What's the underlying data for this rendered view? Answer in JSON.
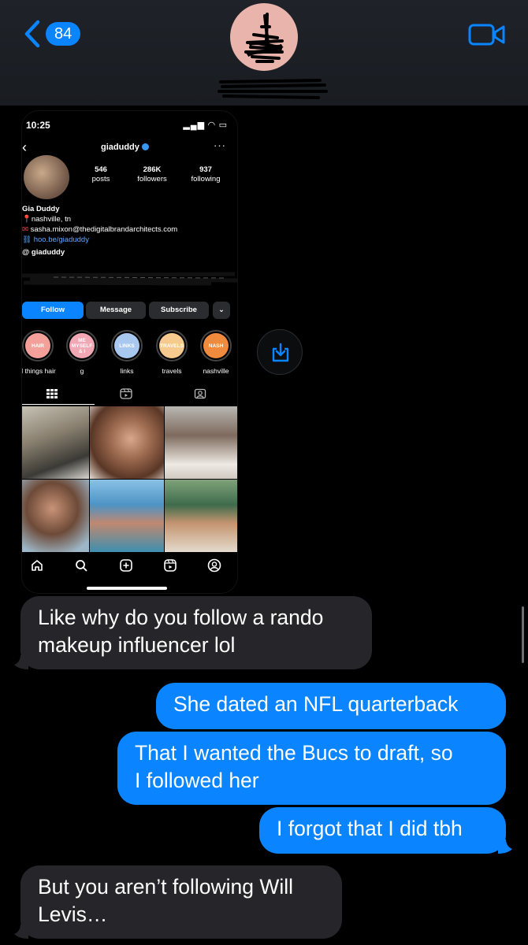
{
  "header": {
    "unread_count": "84",
    "colors": {
      "accent": "#0a84ff",
      "avatar_bg": "#e8b4ab"
    }
  },
  "attachment": {
    "status_time": "10:25",
    "username": "giaduddy",
    "stats": [
      {
        "num": "546",
        "label": "posts"
      },
      {
        "num": "286K",
        "label": "followers"
      },
      {
        "num": "937",
        "label": "following"
      }
    ],
    "bio": {
      "name": "Gia Duddy",
      "location": "nashville, tn",
      "email": "sasha.mixon@thedigitalbrandarchitects.com",
      "link": "hoo.be/giaduddy",
      "threads": "giaduddy"
    },
    "buttons": {
      "follow": "Follow",
      "message": "Message",
      "subscribe": "Subscribe"
    },
    "highlights": [
      {
        "text": "HAIR",
        "label": "ll things hair",
        "color": "#f4a09a"
      },
      {
        "text": "ME MYSELF & I",
        "label": "g",
        "color": "#f1a7b4"
      },
      {
        "text": "LINKS",
        "label": "links",
        "color": "#a8c8f0"
      },
      {
        "text": "TRAVELS",
        "label": "travels",
        "color": "#f6c98e"
      },
      {
        "text": "NASH",
        "label": "nashville",
        "color": "#f08a3c"
      }
    ]
  },
  "messages": [
    {
      "direction": "received",
      "text_1": "Like why do you follow a rando",
      "text_2": "makeup influencer lol"
    },
    {
      "direction": "sent",
      "text_1": "She dated an NFL quarterback"
    },
    {
      "direction": "sent",
      "text_1": "That I wanted the Bucs to draft, so",
      "text_2": "I followed her"
    },
    {
      "direction": "sent",
      "text_1": "I forgot that I did tbh"
    },
    {
      "direction": "received",
      "text_1": "But you aren’t following Will",
      "text_2": "Levis…"
    }
  ]
}
